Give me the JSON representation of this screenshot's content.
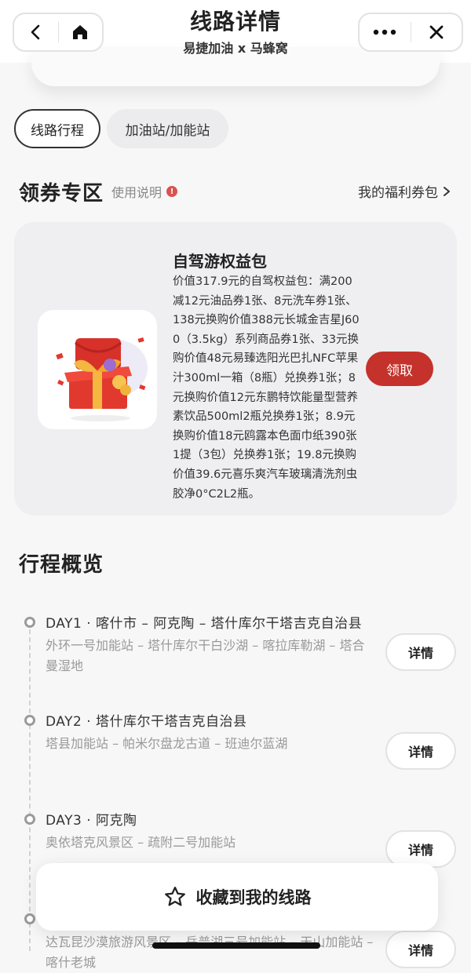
{
  "header": {
    "title": "线路详情",
    "subtitle": "易捷加油 x 马蜂窝",
    "back_icon": "chevron-left-icon",
    "home_icon": "home-icon",
    "more_icon": "more-dots-icon",
    "close_icon": "close-icon"
  },
  "tabs": [
    {
      "label": "线路行程",
      "active": true
    },
    {
      "label": "加油站/加能站",
      "active": false
    }
  ],
  "coupon_section": {
    "title": "领券专区",
    "usage_label": "使用说明",
    "my_bag_label": "我的福利券包"
  },
  "coupon_card": {
    "name": "自驾游权益包",
    "description": "价值317.9元的自驾权益包：满200减12元油品券1张、8元洗车券1张、138元换购价值388元长城金吉星J600（3.5kg）系列商品券1张、33元换购价值48元易臻选阳光巴扎NFC苹果汁300ml一箱（8瓶）兑换券1张；8元换购价值12元东鹏特饮能量型营养素饮品500ml2瓶兑换券1张；8.9元换购价值18元鸥露本色面巾纸390张1提（3包）兑换券1张；19.8元换购价值39.6元喜乐爽汽车玻璃清洗剂虫胶净0°C2L2瓶。",
    "claim_label": "领取",
    "accent_color": "#c4322b"
  },
  "overview": {
    "title": "行程概览",
    "days": [
      {
        "title": "DAY1 · 喀什市 – 阿克陶 – 塔什库尔干塔吉克自治县",
        "route": "外环一号加能站 – 塔什库尔干白沙湖 – 喀拉库勒湖 – 塔合曼湿地",
        "detail_label": "详情"
      },
      {
        "title": "DAY2 · 塔什库尔干塔吉克自治县",
        "route": "塔县加能站 – 帕米尔盘龙古道 – 班迪尔蓝湖",
        "detail_label": "详情"
      },
      {
        "title": "DAY3 · 阿克陶",
        "route": "奥依塔克风景区 – 疏附二号加能站",
        "detail_label": "详情"
      },
      {
        "title": "",
        "route": "达瓦昆沙漠旅游风景区 – 岳普湖三号加能站 – 天山加能站 – 喀什老城",
        "detail_label": "详情"
      }
    ]
  },
  "favorite": {
    "label": "收藏到我的线路",
    "icon": "star-icon"
  }
}
